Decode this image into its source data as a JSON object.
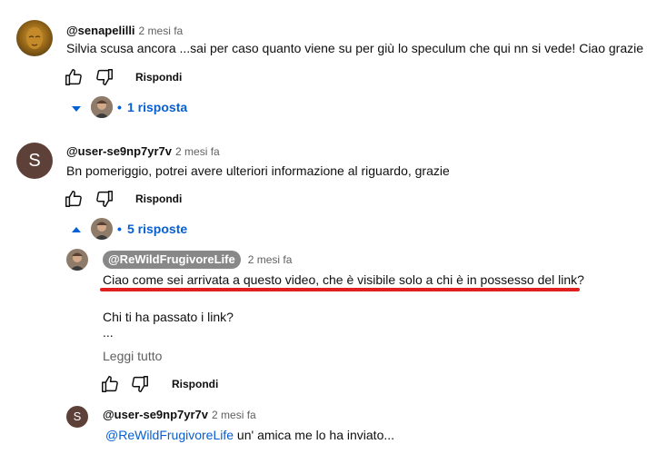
{
  "comments": [
    {
      "handle": "@senapelilli",
      "time": "2 mesi fa",
      "text": "Silvia scusa ancora ...sai per caso  quanto viene su per giù  lo speculum che qui nn si vede! Ciao grazie",
      "reply_label": "Rispondi",
      "toggle_label": "1 risposta",
      "toggle_bullet": "•"
    },
    {
      "handle": "@user-se9np7yr7v",
      "avatar_letter": "S",
      "time": "2 mesi fa",
      "text": "Bn pomeriggio, potrei avere ulteriori informazione al riguardo, grazie",
      "reply_label": "Rispondi",
      "toggle_label": "5 risposte",
      "toggle_bullet": "•",
      "replies": [
        {
          "handle": "@ReWildFrugivoreLife",
          "time": "2 mesi fa",
          "line1": "Ciao come sei arrivata a questo video, che è visibile solo a chi è in possesso del link?",
          "line2": "Chi ti ha passato i link?",
          "line3": "...",
          "read_more": "Leggi tutto",
          "reply_label": "Rispondi"
        },
        {
          "handle": "@user-se9np7yr7v",
          "avatar_letter": "S",
          "time": "2 mesi fa",
          "mention": "@ReWildFrugivoreLife",
          "text": " un' amica me lo ha inviato..."
        }
      ]
    }
  ],
  "colors": {
    "accent_link": "#065fd4",
    "annotation_red": "#e01f1f",
    "letter_avatar": "#5d4037"
  }
}
